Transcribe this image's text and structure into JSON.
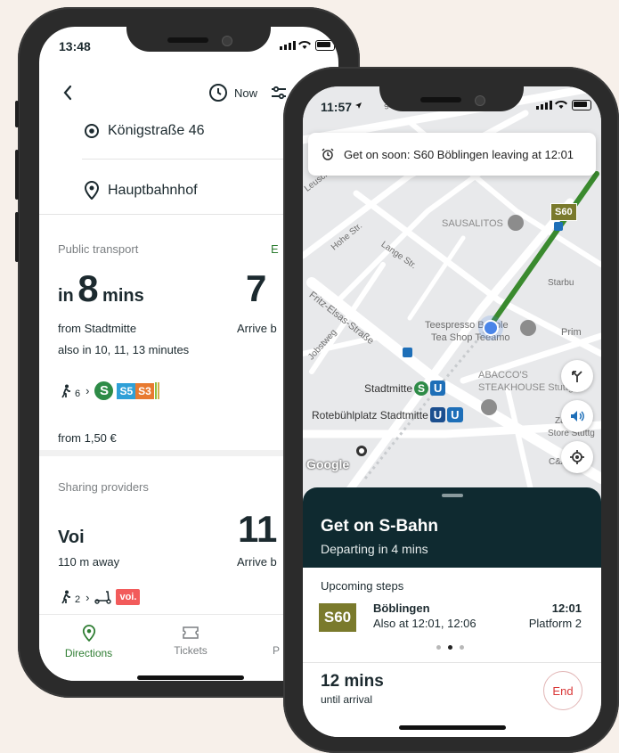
{
  "phone1": {
    "status_time": "13:48",
    "header": {
      "time_label": "Now"
    },
    "from": "Königstraße 46",
    "to": "Hauptbahnhof",
    "public_transport": {
      "section_title": "Public transport",
      "section_link": "E",
      "in_label": "in",
      "minutes": "8",
      "mins_label": "mins",
      "from_stop": "from Stadtmitte",
      "also_in": "also in 10, 11, 13 minutes",
      "arrive_label": "Arrive b",
      "arrive_value": "7",
      "walk_minutes": "6",
      "line_s5": "S5",
      "line_s3": "S3",
      "sbahn_letter": "S",
      "price": "from 1,50 €"
    },
    "sharing": {
      "section_title": "Sharing providers",
      "provider": "Voi",
      "distance": "110 m away",
      "arrive_label": "Arrive b",
      "arrive_value": "11",
      "walk_minutes": "2",
      "brand_badge": "voi."
    },
    "tabs": [
      {
        "label": "Directions"
      },
      {
        "label": "Tickets"
      },
      {
        "label": "P"
      }
    ]
  },
  "phone2": {
    "status_time": "11:57",
    "notification": "Get on soon: S60 Böblingen leaving at 12:01",
    "map_labels": {
      "street1": "Leuschnerstraße",
      "street2": "Hohe Str.",
      "street3": "Lange Str.",
      "street4": "Fritz-Elsas-Straße",
      "street5": "Jobstweg",
      "street6": "straße",
      "poi1": "SAUSALITOS",
      "poi2": "Teespresso Bubble",
      "poi2b": "Tea Shop Teeamo",
      "poi3": "ABACCO'S",
      "poi3b": "STEAKHOUSE Stuttgart",
      "poi4": "Starbu",
      "poi5": "Prim",
      "poi6": "Zal",
      "poi6b": "Store Stuttg",
      "poi7": "C&A",
      "stop1": "Stadtmitte",
      "stop2": "Rotebühlplatz Stadtmitte",
      "s60_badge": "S60",
      "ubahn": "U",
      "sbahn": "S",
      "google": "Google"
    },
    "sheet": {
      "title": "Get on S-Bahn",
      "subtitle": "Departing in 4 mins",
      "upcoming_label": "Upcoming steps",
      "line_badge": "S60",
      "destination": "Böblingen",
      "also_at": "Also at 12:01, 12:06",
      "time": "12:01",
      "platform": "Platform 2",
      "duration": "12 mins",
      "duration_sub": "until arrival",
      "end_button": "End"
    }
  },
  "colors": {
    "accent_green": "#2e7d32",
    "sheet_dark": "#0f2a30",
    "s60_olive": "#7a7a2c"
  }
}
